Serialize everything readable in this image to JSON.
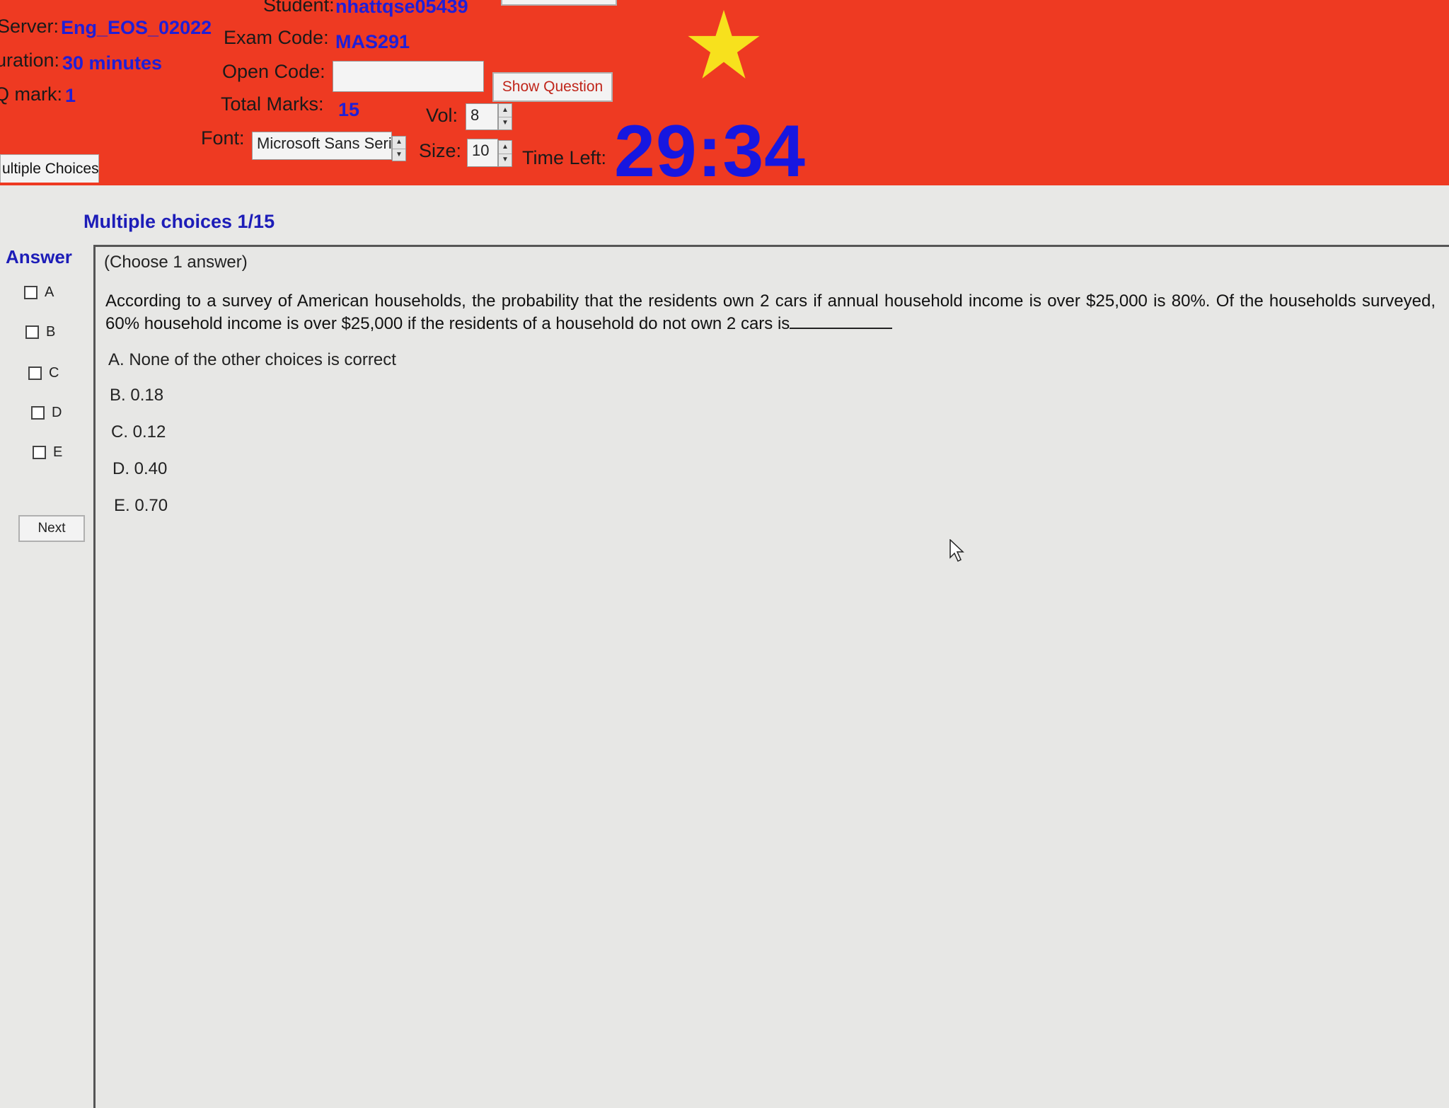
{
  "header": {
    "student_label": "Student:",
    "student_value": "nhattqse05439",
    "server_label": "Server:",
    "server_value": "Eng_EOS_02022",
    "exam_code_label": "Exam Code:",
    "exam_code_value": "MAS291",
    "duration_label": "uration:",
    "duration_value": "30 minutes",
    "open_code_label": "Open Code:",
    "open_code_value": "",
    "show_question_label": "Show Question",
    "qmark_label": "Q mark:",
    "qmark_value": "1",
    "total_marks_label": "Total Marks:",
    "total_marks_value": "15",
    "vol_label": "Vol:",
    "vol_value": "8",
    "font_label": "Font:",
    "font_value": "Microsoft Sans Serif",
    "size_label": "Size:",
    "size_value": "10",
    "time_left_label": "Time Left:",
    "time_left_value": "29:34",
    "star_color": "#f7e11d",
    "bg_color": "#ee3a22"
  },
  "tab": {
    "label": "ultiple Choices"
  },
  "main": {
    "section_title": "Multiple choices 1/15",
    "answer_label": "Answer",
    "answer_options": [
      "A",
      "B",
      "C",
      "D",
      "E"
    ],
    "next_label": "Next",
    "question_sub": "(Choose 1 answer)",
    "question_text": "According to a survey of American households, the probability that the residents own 2 cars if annual household income is over $25,000 is 80%. Of the households surveyed, 60% household income is over $25,000 if the residents of a household do not own 2 cars is",
    "choices": [
      "A. None of the other choices is correct",
      "B. 0.18",
      "C. 0.12",
      "D. 0.40",
      "E. 0.70"
    ]
  }
}
